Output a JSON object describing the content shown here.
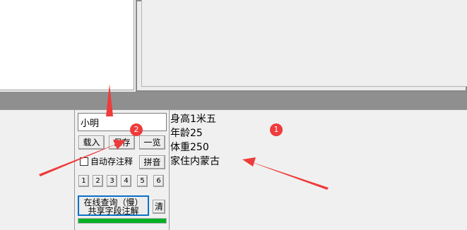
{
  "name_input": {
    "value": "小明"
  },
  "buttons": {
    "load": "载入",
    "save": "保存",
    "overview": "一览",
    "pinyin": "拼音",
    "clear": "清"
  },
  "auto_save": {
    "label": "自动存注释",
    "checked": false
  },
  "number_buttons": [
    "1",
    "2",
    "3",
    "4",
    "5",
    "6"
  ],
  "online_query": {
    "line1": "在线查询（慢）",
    "line2": "共享字段注解"
  },
  "progress": {
    "fraction": 1.0,
    "color": "#06b025"
  },
  "notes": [
    "身高1米五",
    "年龄25",
    "体重250",
    "家住内蒙古"
  ],
  "annotations": {
    "badges": [
      "1",
      "2"
    ],
    "color": "#ef3b3b"
  }
}
